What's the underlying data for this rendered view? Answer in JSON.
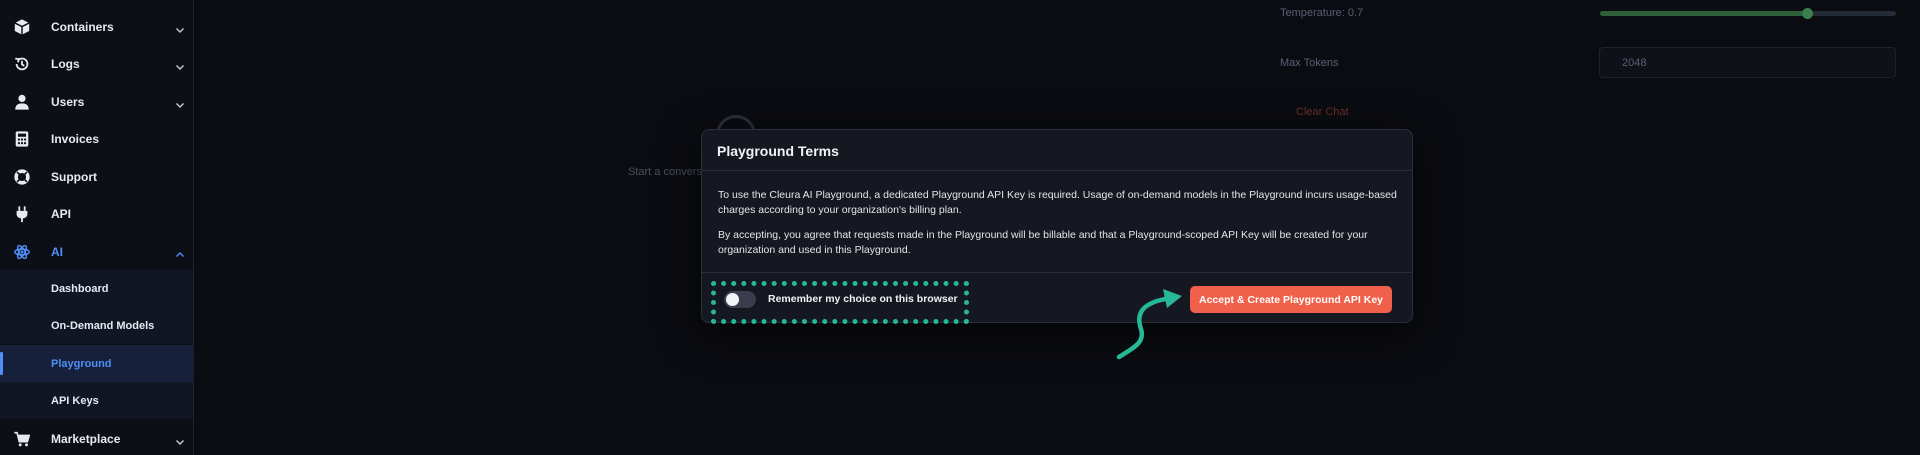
{
  "sidebar": {
    "items": [
      {
        "label": "Containers",
        "icon": "box-icon"
      },
      {
        "label": "Logs",
        "icon": "history-icon"
      },
      {
        "label": "Users",
        "icon": "user-icon"
      },
      {
        "label": "Invoices",
        "icon": "calculator-icon"
      },
      {
        "label": "Support",
        "icon": "lifebuoy-icon"
      },
      {
        "label": "API",
        "icon": "plug-icon"
      },
      {
        "label": "AI",
        "icon": "ai-icon"
      },
      {
        "label": "Marketplace",
        "icon": "cart-icon"
      }
    ],
    "ai_sub_items": [
      {
        "label": "Dashboard"
      },
      {
        "label": "On-Demand Models"
      },
      {
        "label": "Playground"
      },
      {
        "label": "API Keys"
      }
    ],
    "active_item": "AI",
    "active_sub_item": "Playground",
    "accent_color": "#4f8ff7"
  },
  "settings": {
    "temperature_label": "Temperature: 0.7",
    "temperature_value": 0.7,
    "temperature_max": 1,
    "max_tokens_label": "Max Tokens",
    "max_tokens_value": "2048",
    "clear_chat_label": "Clear Chat"
  },
  "chat": {
    "hint": "Start a conversa"
  },
  "modal": {
    "title": "Playground Terms",
    "paragraph_1": "To use the Cleura AI Playground, a dedicated Playground API Key is required. Usage of on-demand models in the Playground incurs usage-based charges according to your organization's billing plan.",
    "paragraph_2": "By accepting, you agree that requests made in the Playground will be billable and that a Playground-scoped API Key will be created for your organization and used in this Playground.",
    "remember_label": "Remember my choice on this browser",
    "remember_checked": false,
    "accept_label": "Accept & Create Playground API Key",
    "accept_color": "#f0604a"
  },
  "annotation": {
    "highlight_color": "#27b897"
  }
}
